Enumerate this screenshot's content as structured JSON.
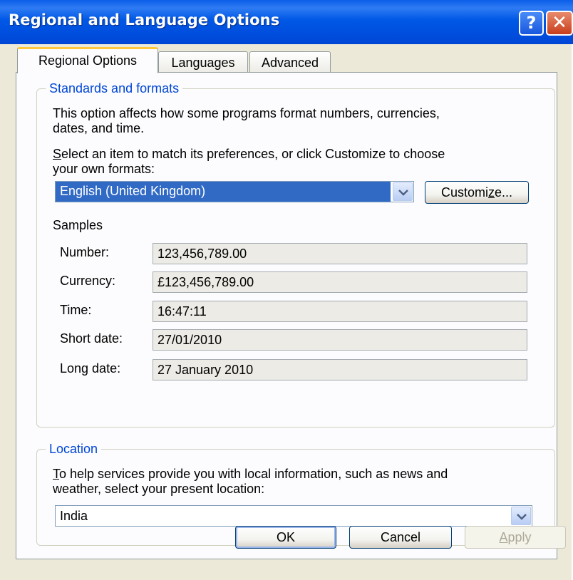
{
  "window": {
    "title": "Regional and Language Options"
  },
  "titlebar_buttons": {
    "help": "?",
    "close": "✕"
  },
  "tabs": [
    {
      "label": "Regional Options",
      "active": true
    },
    {
      "label": "Languages",
      "active": false
    },
    {
      "label": "Advanced",
      "active": false
    }
  ],
  "standards": {
    "group_title": "Standards and formats",
    "description_line1": "This option affects how some programs format numbers, currencies,",
    "description_line2": "dates, and time.",
    "select_line1_mnemonic": "S",
    "select_line1_rest": "elect an item to match its preferences, or click Customize to choose",
    "select_line2": "your own formats:",
    "format_value": "English (United Kingdom)",
    "customize_before": "Customi",
    "customize_mnemonic": "z",
    "customize_after": "e...",
    "samples_label": "Samples",
    "samples": [
      {
        "label": "Number:",
        "value": "123,456,789.00"
      },
      {
        "label": "Currency:",
        "value": "£123,456,789.00"
      },
      {
        "label": "Time:",
        "value": "16:47:11"
      },
      {
        "label": "Short date:",
        "value": "27/01/2010"
      },
      {
        "label": "Long date:",
        "value": "27 January 2010"
      }
    ]
  },
  "location": {
    "group_title": "Location",
    "line1_mnemonic": "T",
    "line1_rest": "o help services provide you with local information, such as news and",
    "line2": "weather, select your present location:",
    "value": "India"
  },
  "footer": {
    "ok": "OK",
    "cancel": "Cancel",
    "apply_mnemonic": "A",
    "apply_rest": "pply"
  },
  "colors": {
    "titlebar": "#0058e6",
    "group_title": "#0046d5",
    "selection": "#316ac5",
    "active_tab_highlight": "#ffc83c"
  }
}
